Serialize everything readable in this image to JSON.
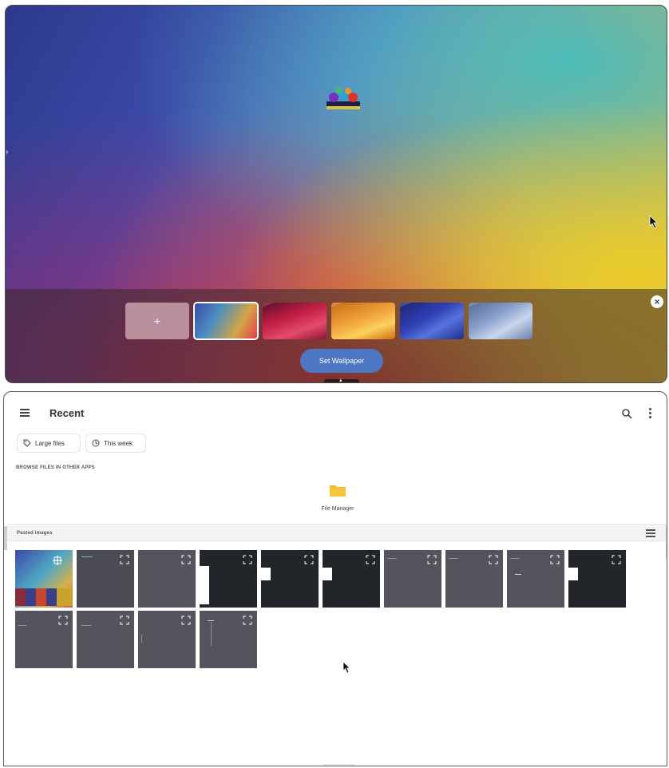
{
  "wallpaper_picker": {
    "close_icon_glyph": "×",
    "add_glyph": "+",
    "thumbnails": [
      "add",
      "gradient-rainbow",
      "red-waves",
      "orange-waves",
      "blue-waves",
      "silver-waves"
    ],
    "selected_index": 1,
    "set_button_label": "Set Wallpaper",
    "accent": "#4d76c3"
  },
  "file_manager": {
    "title": "Recent",
    "chips": [
      {
        "label": "Large files",
        "icon": "tag-icon"
      },
      {
        "label": "This week",
        "icon": "clock-icon"
      }
    ],
    "browse_section_label": "BROWSE FILES IN OTHER APPS",
    "apps": [
      {
        "label": "File Manager",
        "icon": "folder-icon",
        "color": "#f2b824"
      }
    ],
    "pasted_section_label": "Pasted images",
    "images_count": 14
  }
}
